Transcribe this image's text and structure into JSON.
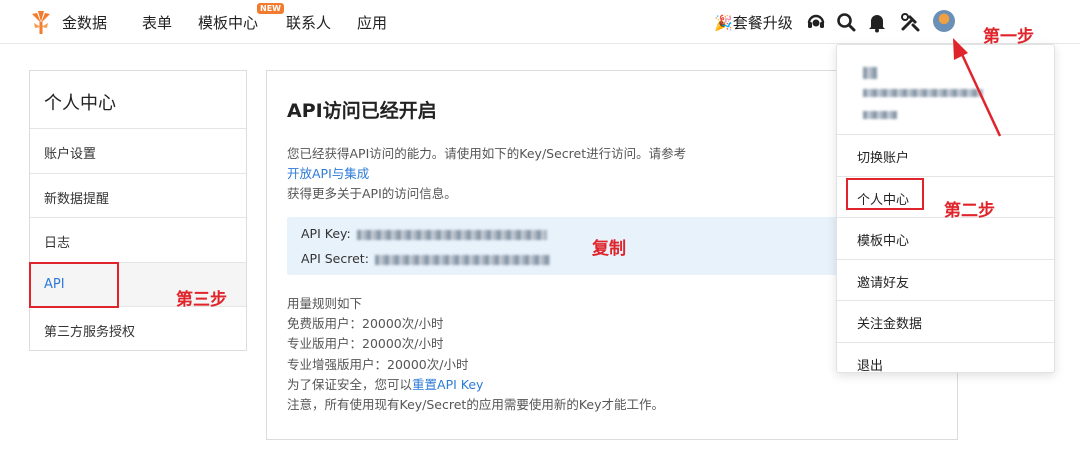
{
  "nav": {
    "brand": "金数据",
    "items": [
      "表单",
      "模板中心",
      "联系人",
      "应用"
    ],
    "new_badge": "NEW",
    "upgrade": "套餐升级"
  },
  "sidebar": {
    "title": "个人中心",
    "items": [
      "账户设置",
      "新数据提醒",
      "日志",
      "API",
      "第三方服务授权"
    ]
  },
  "card": {
    "title": "API访问已经开启",
    "desc_line1": "您已经获得API访问的能力。请使用如下的Key/Secret进行访问。请参考",
    "desc_link": "开放API与集成",
    "desc_line3": "获得更多关于API的访问信息。",
    "api_key_label": "API Key:",
    "api_secret_label": "API Secret:",
    "usage_title": "用量规则如下",
    "usage_free": "免费版用户：20000次/小时",
    "usage_pro": "专业版用户：20000次/小时",
    "usage_pro_plus": "专业增强版用户：20000次/小时",
    "reset_prefix": "为了保证安全，您可以",
    "reset_link": "重置API Key",
    "notice": "注意，所有使用现有Key/Secret的应用需要使用新的Key才能工作。"
  },
  "dropdown": {
    "items": [
      "切换账户",
      "个人中心",
      "模板中心",
      "邀请好友",
      "关注金数据",
      "退出"
    ]
  },
  "annotations": {
    "step1": "第一步",
    "step2": "第二步",
    "step3": "第三步",
    "copy": "复制"
  },
  "colors": {
    "accent_link": "#2d7bd8",
    "annotation_red": "#e0242b",
    "brand_orange": "#f27b2e",
    "keybox_bg": "#e8f2fb"
  }
}
